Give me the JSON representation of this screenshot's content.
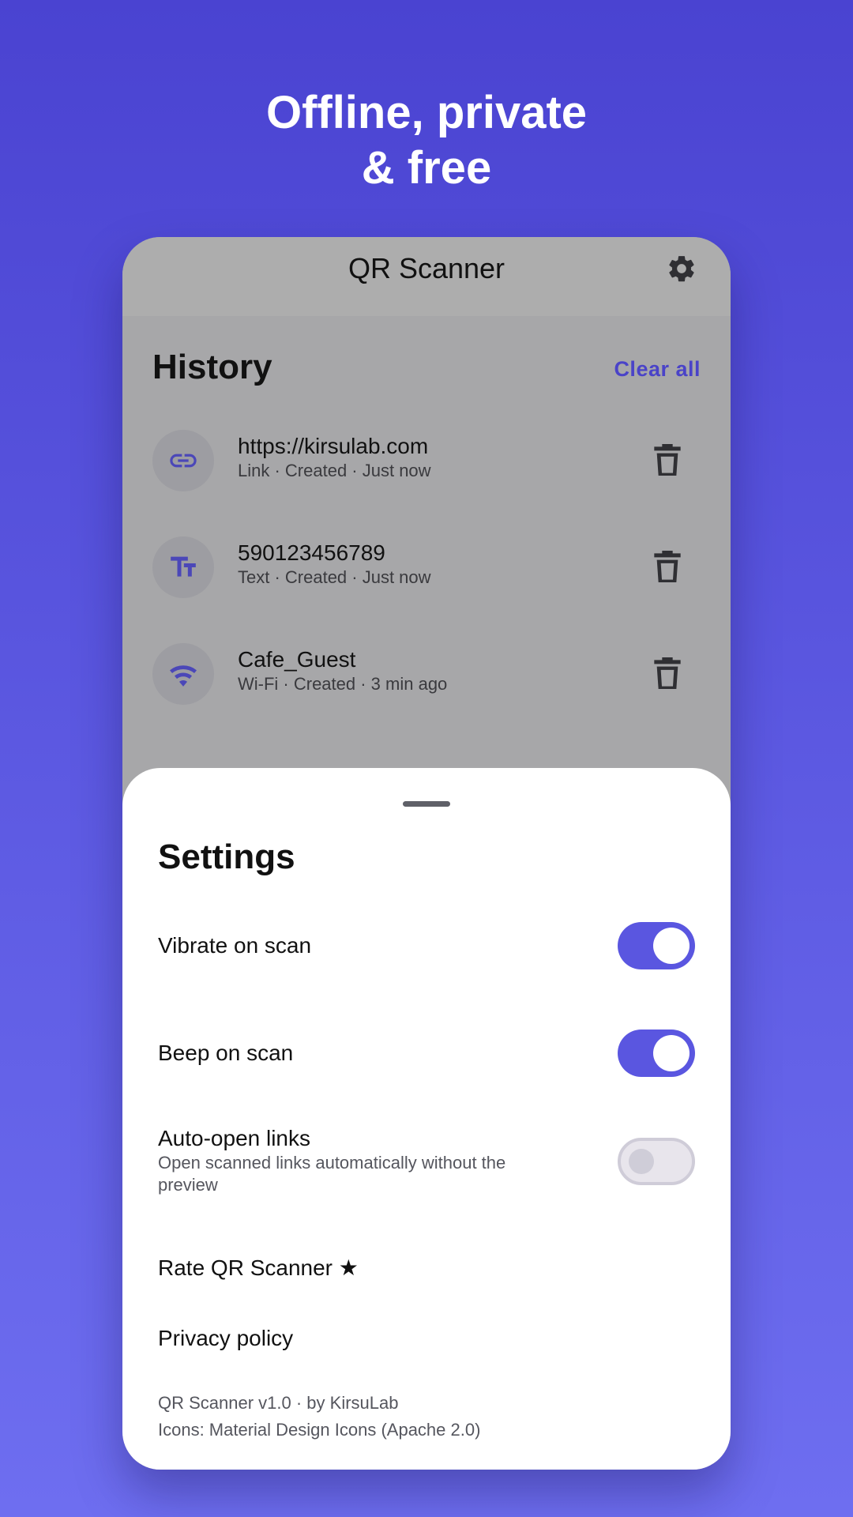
{
  "headline": {
    "line1": "Offline, private",
    "line2": "& free"
  },
  "app": {
    "title": "QR Scanner",
    "settings_icon": "gear-icon"
  },
  "history": {
    "title": "History",
    "clear_all": "Clear all",
    "items": [
      {
        "value": "https://kirsulab.com",
        "meta": "Link · Created · Just now",
        "icon": "link-icon"
      },
      {
        "value": "590123456789",
        "meta": "Text · Created · Just now",
        "icon": "text-format-icon"
      },
      {
        "value": "Cafe_Guest",
        "meta": "Wi-Fi · Created · 3 min ago",
        "icon": "wifi-icon"
      }
    ]
  },
  "settings": {
    "title": "Settings",
    "vibrate": {
      "label": "Vibrate on scan",
      "enabled": true
    },
    "beep": {
      "label": "Beep on scan",
      "enabled": true
    },
    "auto_open": {
      "label": "Auto-open links",
      "description": "Open scanned links automatically without the preview",
      "enabled": false
    },
    "rate": "Rate QR Scanner ★",
    "privacy": "Privacy policy",
    "footer_version": "QR Scanner v1.0 · by KirsuLab",
    "footer_icons": "Icons: Material Design Icons (Apache 2.0)"
  },
  "colors": {
    "accent": "#5a56e0",
    "link": "#4a43c8",
    "background_top": "#4a43d1",
    "background_bottom": "#6e6ef0"
  }
}
